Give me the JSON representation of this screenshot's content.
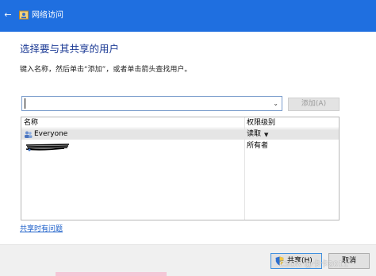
{
  "window": {
    "title": "网络访问"
  },
  "heading": "选择要与其共享的用户",
  "instruction": "键入名称，然后单击“添加”，或者单击箭头查找用户。",
  "name_input": {
    "value": "",
    "placeholder": ""
  },
  "buttons": {
    "add": "添加(A)",
    "share": "共享(H)",
    "cancel": "取消"
  },
  "table": {
    "headers": {
      "name": "名称",
      "permission": "权限级别"
    },
    "rows": [
      {
        "name": "Everyone",
        "permission": "读取",
        "selected": true
      },
      {
        "name": "",
        "permission": "所有者",
        "selected": false
      }
    ]
  },
  "help_link": "共享时有问题",
  "watermark": "CSDN @卡卡2011",
  "colors": {
    "titlebar": "#1f6fe0",
    "heading": "#1e3c96",
    "link": "#1c5fc9",
    "selected_row": "#e5e5e5"
  }
}
